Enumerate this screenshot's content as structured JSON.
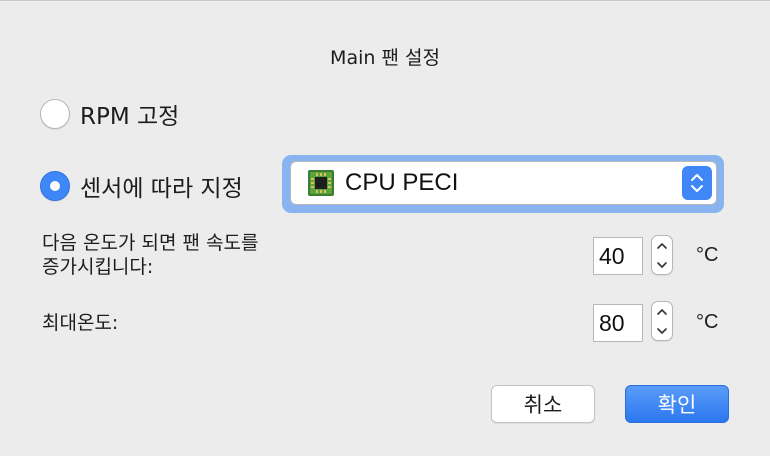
{
  "dialog": {
    "title": "Main 팬 설정"
  },
  "mode": {
    "fixed_rpm_label": "RPM 고정",
    "fixed_rpm_selected": false,
    "sensor_label": "센서에 따라 지정",
    "sensor_selected": true
  },
  "sensor_select": {
    "value": "CPU PECI",
    "icon": "cpu-chip-icon"
  },
  "start_temp": {
    "label_line1": "다음 온도가 되면 팬 속도를",
    "label_line2": "증가시킵니다:",
    "value": "40",
    "unit": "°C"
  },
  "max_temp": {
    "label": "최대온도:",
    "value": "80",
    "unit": "°C"
  },
  "buttons": {
    "cancel": "취소",
    "ok": "확인"
  },
  "colors": {
    "accent": "#3f86f7",
    "focus_ring": "#8ab4f0",
    "background": "#ececec"
  }
}
